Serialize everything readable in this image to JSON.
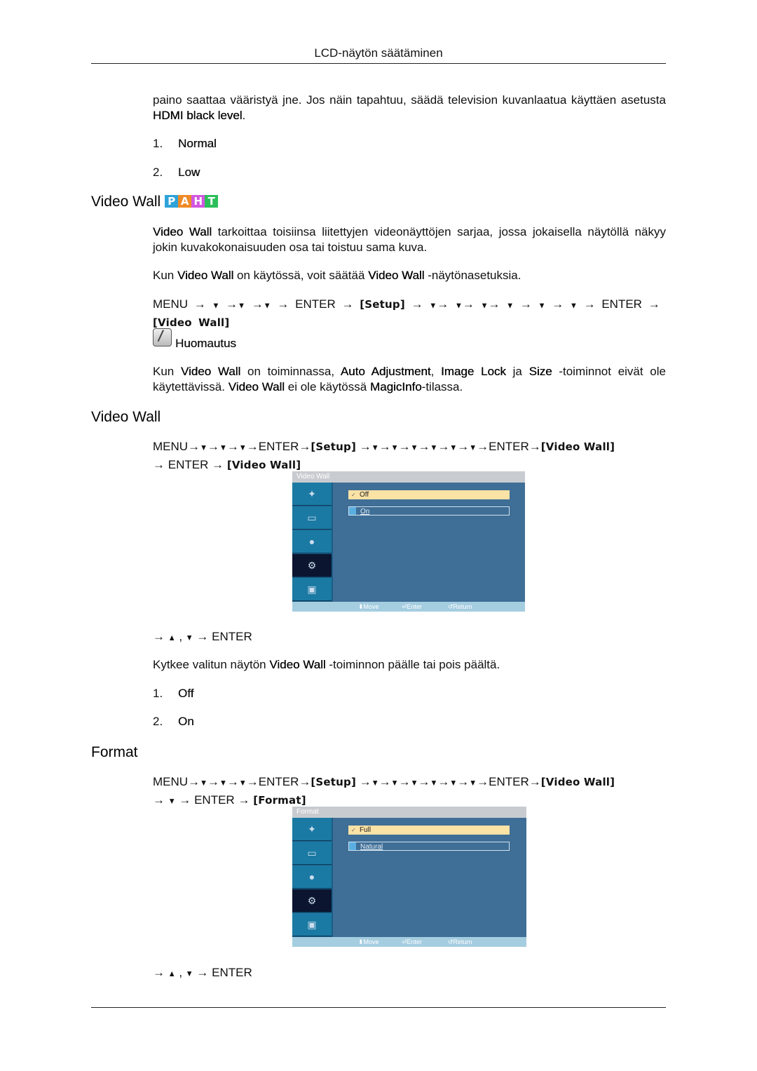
{
  "header": {
    "title": "LCD-näytön säätäminen"
  },
  "intro": {
    "text_before": "paino saattaa vääristyä jne. Jos näin tapahtuu, säädä television kuvanlaatua käyttäen asetusta ",
    "bold": "HDMI black level",
    "text_after": "."
  },
  "list1": [
    {
      "num": "1.",
      "label": "Normal"
    },
    {
      "num": "2.",
      "label": "Low"
    }
  ],
  "section1": {
    "heading": "Video Wall",
    "badges": [
      {
        "letter": "P",
        "color": "#2ea3d8"
      },
      {
        "letter": "A",
        "color": "#f08a26"
      },
      {
        "letter": "H",
        "color": "#d257e0"
      },
      {
        "letter": "T",
        "color": "#2bbf5a"
      }
    ],
    "para1_bold": "Video Wall",
    "para1_text": " tarkoittaa toisiinsa liitettyjen videonäyttöjen sarjaa, jossa jokaisella näytöllä näkyy jokin kuvakokonaisuuden osa tai toistuu sama kuva.",
    "para2": [
      "Kun ",
      "Video Wall",
      " on käytössä, voit säätää ",
      "Video Wall",
      " -näytönasetuksia."
    ],
    "path": {
      "menu": "MENU",
      "arrow": "→",
      "down": "▼",
      "up": "▲",
      "enter": "ENTER",
      "setup": "[Setup]",
      "videowall": "[Video Wall]",
      "format": "[Format]"
    },
    "note_label": "Huomautus",
    "note": [
      "Kun ",
      "Video Wall",
      " on toiminnassa, ",
      "Auto Adjustment",
      ", ",
      "Image Lock",
      " ja ",
      "Size",
      " -toiminnot eivät ole käytettävissä. ",
      "Video Wall",
      " ei ole käytössä ",
      "MagicInfo",
      "-tilassa."
    ]
  },
  "section2": {
    "heading": "Video Wall",
    "osd": {
      "title": "Video Wall",
      "options": [
        "Off",
        "On"
      ],
      "selected": "Off",
      "footer": {
        "move": "Move",
        "enter": "Enter",
        "return": "Return"
      }
    },
    "nav": "ENTER",
    "desc": [
      "Kytkee valitun näytön ",
      "Video Wall",
      " -toiminnon päälle tai pois päältä."
    ],
    "list": [
      {
        "num": "1.",
        "label": "Off"
      },
      {
        "num": "2.",
        "label": "On"
      }
    ]
  },
  "section3": {
    "heading": "Format",
    "osd": {
      "title": "Format",
      "options": [
        "Full",
        "Natural"
      ],
      "selected": "Full",
      "footer": {
        "move": "Move",
        "enter": "Enter",
        "return": "Return"
      }
    },
    "nav": "ENTER"
  }
}
